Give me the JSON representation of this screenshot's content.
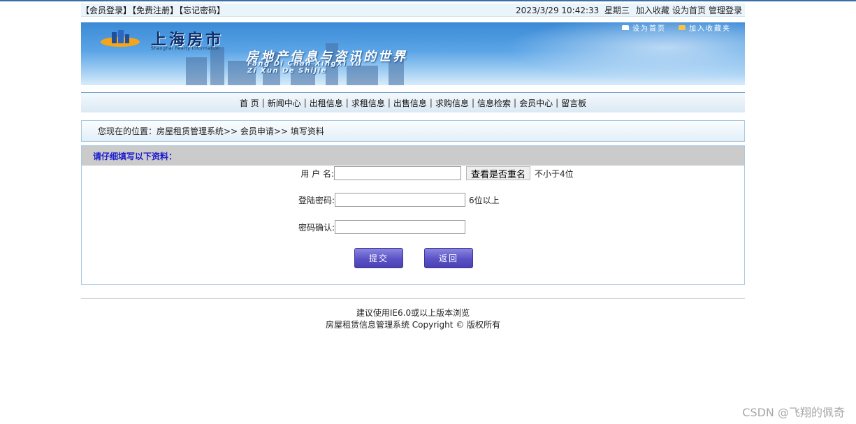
{
  "topbar": {
    "left_links": [
      "【会员登录】",
      "【免费注册】",
      "【忘记密码】"
    ],
    "datetime": "2023/3/29 10:42:33",
    "weekday": "星期三",
    "right_links": [
      "加入收藏",
      "设为首页",
      "管理登录"
    ]
  },
  "banner": {
    "logo_text": "上海房市",
    "logo_sub": "Shanghai Realty Information",
    "slogan": "房地产信息与咨讯的世界",
    "pinyin_line1": "Fang Di Chan XingXi Yu",
    "pinyin_line2": "Zi Xun De ShiJie",
    "tool_home": "设为首页",
    "tool_fav": "加入收藏夹"
  },
  "nav": {
    "items": [
      "首 页",
      "新闻中心",
      "出租信息",
      "求租信息",
      "出售信息",
      "求购信息",
      "信息检索",
      "会员中心",
      "留言板"
    ],
    "separator": "|"
  },
  "breadcrumb": {
    "text": "您现在的位置：房屋租赁管理系统>> 会员申请>> 填写资料"
  },
  "form": {
    "header": "请仔细填写以下资料：",
    "username_label": "用 户 名:",
    "username_value": "",
    "check_button": "查看是否重名",
    "username_hint": "不小于4位",
    "password_label": "登陆密码:",
    "password_value": "",
    "password_hint": "6位以上",
    "confirm_label": "密码确认:",
    "confirm_value": "",
    "submit_label": "提交",
    "back_label": "返回"
  },
  "footer": {
    "line1": "建议使用IE6.0或以上版本浏览",
    "line2": "房屋租赁信息管理系统 Copyright © 版权所有"
  },
  "watermark": "CSDN @飞翔的佩奇"
}
